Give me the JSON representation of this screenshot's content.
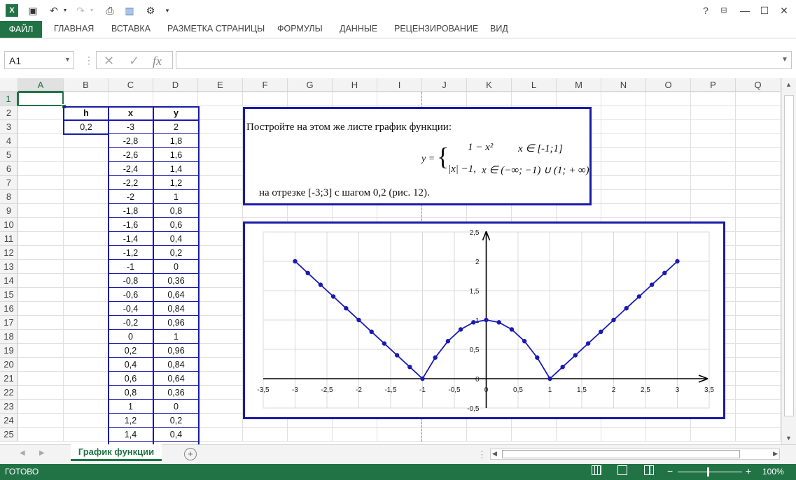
{
  "quick_access": {
    "excel_icon": "X",
    "save_icon": "save-icon",
    "undo_icon": "undo-icon",
    "redo_icon": "redo-icon"
  },
  "window": {
    "help": "?",
    "minimize": "—",
    "maximize": "☐",
    "close": "✕"
  },
  "ribbon_tabs": [
    "ФАЙЛ",
    "ГЛАВНАЯ",
    "ВСТАВКА",
    "РАЗМЕТКА СТРАНИЦЫ",
    "ФОРМУЛЫ",
    "ДАННЫЕ",
    "РЕЦЕНЗИРОВАНИЕ",
    "ВИД"
  ],
  "formula_bar": {
    "name_box": "A1",
    "cancel": "✕",
    "enter": "✓",
    "fx": "fx",
    "formula": ""
  },
  "columns": [
    "A",
    "B",
    "C",
    "D",
    "E",
    "F",
    "G",
    "H",
    "I",
    "J",
    "K",
    "L",
    "M",
    "N",
    "O",
    "P",
    "Q"
  ],
  "rows": [
    "1",
    "2",
    "3",
    "4",
    "5",
    "6",
    "7",
    "8",
    "9",
    "10",
    "11",
    "12",
    "13",
    "14",
    "15",
    "16",
    "17",
    "18",
    "19",
    "20",
    "21",
    "22",
    "23",
    "24",
    "25"
  ],
  "table": {
    "h_header": "h",
    "h_value": "0,2",
    "x_header": "x",
    "y_header": "y",
    "x": [
      "-3",
      "-2,8",
      "-2,6",
      "-2,4",
      "-2,2",
      "-2",
      "-1,8",
      "-1,6",
      "-1,4",
      "-1,2",
      "-1",
      "-0,8",
      "-0,6",
      "-0,4",
      "-0,2",
      "0",
      "0,2",
      "0,4",
      "0,6",
      "0,8",
      "1",
      "1,2",
      "1,4"
    ],
    "y": [
      "2",
      "1,8",
      "1,6",
      "1,4",
      "1,2",
      "1",
      "0,8",
      "0,6",
      "0,4",
      "0,2",
      "0",
      "0,36",
      "0,64",
      "0,84",
      "0,96",
      "1",
      "0,96",
      "0,84",
      "0,64",
      "0,36",
      "0",
      "0,2",
      "0,4"
    ]
  },
  "task": {
    "line1": "Постройте на этом же листе график функции:",
    "formula_y": "y =",
    "piece1_expr": "1 − x²",
    "piece1_domain": "x ∈ [-1;1]",
    "piece2_expr": "|x| −1,",
    "piece2_domain": "x ∈ (−∞; −1) ∪ (1; + ∞)",
    "line2": "на отрезке [-3;3] с шагом 0,2 (рис. 12)."
  },
  "chart_data": {
    "type": "scatter",
    "x": [
      -3,
      -2.8,
      -2.6,
      -2.4,
      -2.2,
      -2,
      -1.8,
      -1.6,
      -1.4,
      -1.2,
      -1,
      -0.8,
      -0.6,
      -0.4,
      -0.2,
      0,
      0.2,
      0.4,
      0.6,
      0.8,
      1,
      1.2,
      1.4,
      1.6,
      1.8,
      2,
      2.2,
      2.4,
      2.6,
      2.8,
      3
    ],
    "y": [
      2,
      1.8,
      1.6,
      1.4,
      1.2,
      1,
      0.8,
      0.6,
      0.4,
      0.2,
      0,
      0.36,
      0.64,
      0.84,
      0.96,
      1,
      0.96,
      0.84,
      0.64,
      0.36,
      0,
      0.2,
      0.4,
      0.6,
      0.8,
      1,
      1.2,
      1.4,
      1.6,
      1.8,
      2
    ],
    "x_ticks": [
      "-3,5",
      "-3",
      "-2,5",
      "-2",
      "-1,5",
      "-1",
      "-0,5",
      "0",
      "0,5",
      "1",
      "1,5",
      "2",
      "2,5",
      "3",
      "3,5"
    ],
    "y_ticks": [
      "-0,5",
      "0",
      "0,5",
      "1",
      "1,5",
      "2",
      "2,5"
    ],
    "xlim": [
      -3.5,
      3.5
    ],
    "ylim": [
      -0.5,
      2.5
    ],
    "grid": true,
    "line_color": "#1a1ab4",
    "marker": "circle"
  },
  "sheet_tab": "График функции",
  "status": {
    "ready": "ГОТОВО",
    "zoom": "100%"
  }
}
